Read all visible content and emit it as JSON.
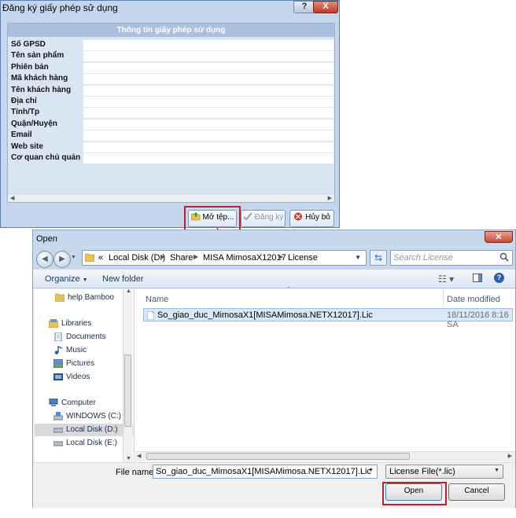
{
  "registration_dialog": {
    "title": "Đăng ký giấy phép sử dụng",
    "help_button": "?",
    "close_button": "X",
    "section_title": "Thông tin giấy phép sử dụng",
    "fields": [
      {
        "label": "Số GPSD",
        "value": ""
      },
      {
        "label": "Tên sản phẩm",
        "value": ""
      },
      {
        "label": "Phiên bản",
        "value": ""
      },
      {
        "label": "Mã khách hàng",
        "value": ""
      },
      {
        "label": "Tên khách hàng",
        "value": ""
      },
      {
        "label": "Địa chỉ",
        "value": ""
      },
      {
        "label": "Tỉnh/Tp",
        "value": ""
      },
      {
        "label": "Quận/Huyện",
        "value": ""
      },
      {
        "label": "Email",
        "value": ""
      },
      {
        "label": "Web site",
        "value": ""
      },
      {
        "label": "Cơ quan chủ quản",
        "value": ""
      }
    ],
    "buttons": {
      "open_file": "Mở tệp...",
      "register": "Đăng ký",
      "cancel": "Hủy bỏ"
    }
  },
  "open_dialog": {
    "title": "Open",
    "breadcrumb": [
      "«",
      "Local Disk (D:)",
      "Share",
      "MISA MimosaX12017",
      "License"
    ],
    "search_placeholder": "Search License",
    "toolbar": {
      "organize": "Organize",
      "new_folder": "New folder"
    },
    "sidebar": [
      {
        "label": "help Bamboo",
        "icon": "folder-icon"
      },
      {
        "label": "Libraries",
        "icon": "libraries-icon"
      },
      {
        "label": "Documents",
        "icon": "documents-icon"
      },
      {
        "label": "Music",
        "icon": "music-icon"
      },
      {
        "label": "Pictures",
        "icon": "pictures-icon"
      },
      {
        "label": "Videos",
        "icon": "videos-icon"
      },
      {
        "label": "Computer",
        "icon": "computer-icon"
      },
      {
        "label": "WINDOWS (C:)",
        "icon": "drive-icon"
      },
      {
        "label": "Local Disk (D:)",
        "icon": "drive-icon",
        "selected": true
      },
      {
        "label": "Local Disk (E:)",
        "icon": "drive-icon"
      }
    ],
    "columns": {
      "name": "Name",
      "date": "Date modified"
    },
    "files": [
      {
        "name": "So_giao_duc_MimosaX1[MISAMimosa.NETX12017].Lic",
        "date": "18/11/2016 8:16 SA"
      }
    ],
    "file_name_label": "File name:",
    "file_name_value": "So_giao_duc_MimosaX1[MISAMimosa.NETX12017].Lic",
    "file_type": "License File(*.lic)",
    "open_button": "Open",
    "cancel_button": "Cancel"
  },
  "colors": {
    "highlight": "#c0202a",
    "arrow": "#c0202a"
  }
}
